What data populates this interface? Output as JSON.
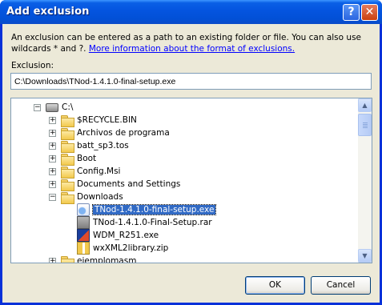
{
  "window": {
    "title": "Add exclusion",
    "help_label": "?",
    "close_label": "✕"
  },
  "description": {
    "text": "An exclusion can be entered as a path to an existing folder or file. You can also use wildcards * and ?.",
    "link_text": "More information about the format of exclusions."
  },
  "exclusion": {
    "label": "Exclusion:",
    "value": "C:\\Downloads\\TNod-1.4.1.0-final-setup.exe"
  },
  "tree": {
    "root": {
      "label": "C:\\"
    },
    "items": [
      {
        "label": "$RECYCLE.BIN",
        "expander": "+"
      },
      {
        "label": "Archivos de programa",
        "expander": "+"
      },
      {
        "label": "batt_sp3.tos",
        "expander": "+"
      },
      {
        "label": "Boot",
        "expander": "+"
      },
      {
        "label": "Config.Msi",
        "expander": "+"
      },
      {
        "label": "Documents and Settings",
        "expander": "+"
      },
      {
        "label": "Downloads",
        "expander": "−"
      }
    ],
    "downloads_children": [
      {
        "label": "TNod-1.4.1.0-final-setup.exe",
        "icon": "setup-icon",
        "selected": true
      },
      {
        "label": "TNod-1.4.1.0-Final-Setup.rar",
        "icon": "rar-icon"
      },
      {
        "label": "WDM_R251.exe",
        "icon": "exe-icon"
      },
      {
        "label": "wxXML2library.zip",
        "icon": "zip-icon"
      }
    ],
    "last_item": {
      "label": "ejemplomasm",
      "expander": "+"
    }
  },
  "buttons": {
    "ok": "OK",
    "cancel": "Cancel"
  },
  "colors": {
    "title_bar": "#0454df",
    "selection": "#316ac5",
    "dialog_bg": "#ece9d8"
  }
}
